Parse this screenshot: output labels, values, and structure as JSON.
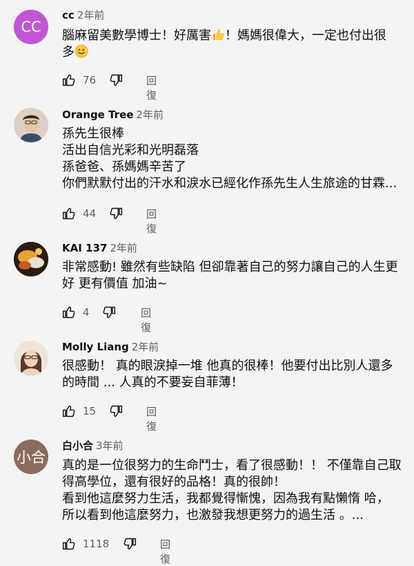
{
  "comments": [
    {
      "author": "cc",
      "time": "2年前",
      "avatar": {
        "text": "CC",
        "color": "#c255d6"
      },
      "lines": [
        "腦麻留美數學博士！好厲害",
        "！媽媽很偉大，一定也付出很",
        "多"
      ],
      "likes": "76",
      "reply": "回復"
    },
    {
      "author": "Orange Tree",
      "time": "2年前",
      "avatar": {
        "text": "",
        "color": "#d9c9b8"
      },
      "lines": [
        "孫先生很棒",
        "活出自信光彩和光明磊落",
        "孫爸爸、孫媽媽辛苦了",
        "你們默默付出的汗水和淚水已經化作孫先生人生旅途的甘霖..."
      ],
      "likes": "44",
      "reply": "回復"
    },
    {
      "author": "KAI 137",
      "time": "2年前",
      "avatar": {
        "text": "",
        "color": "#3a2a1a"
      },
      "lines": [
        "非常感動! 雖然有些缺陷 但卻靠著自己的努力讓自己的人生更",
        "好 更有價值 加油~"
      ],
      "likes": "4",
      "reply": "回復"
    },
    {
      "author": "Molly Liang",
      "time": "2年前",
      "avatar": {
        "text": "",
        "color": "#e8d6c8"
      },
      "lines": [
        "很感動！ 真的眼淚掉一堆 他真的很棒！他要付出比別人還多",
        "的時間 ... 人真的不要妄自菲薄！"
      ],
      "likes": "15",
      "reply": "回復"
    },
    {
      "author": "白小合",
      "time": "3年前",
      "avatar": {
        "text": "小合",
        "color": "#8c6b5d"
      },
      "lines": [
        "真的是一位很努力的生命鬥士，看了很感動！！ 不僅靠自己取",
        "得高學位，還有很好的品格！真的很帥！",
        "看到他這麼努力生活，我都覺得慚愧，因為我有點懶惰 哈，",
        "所以看到他這麼努力，也激發我想更努力的過生活 。..."
      ],
      "likes": "1118",
      "reply": "回復"
    }
  ]
}
